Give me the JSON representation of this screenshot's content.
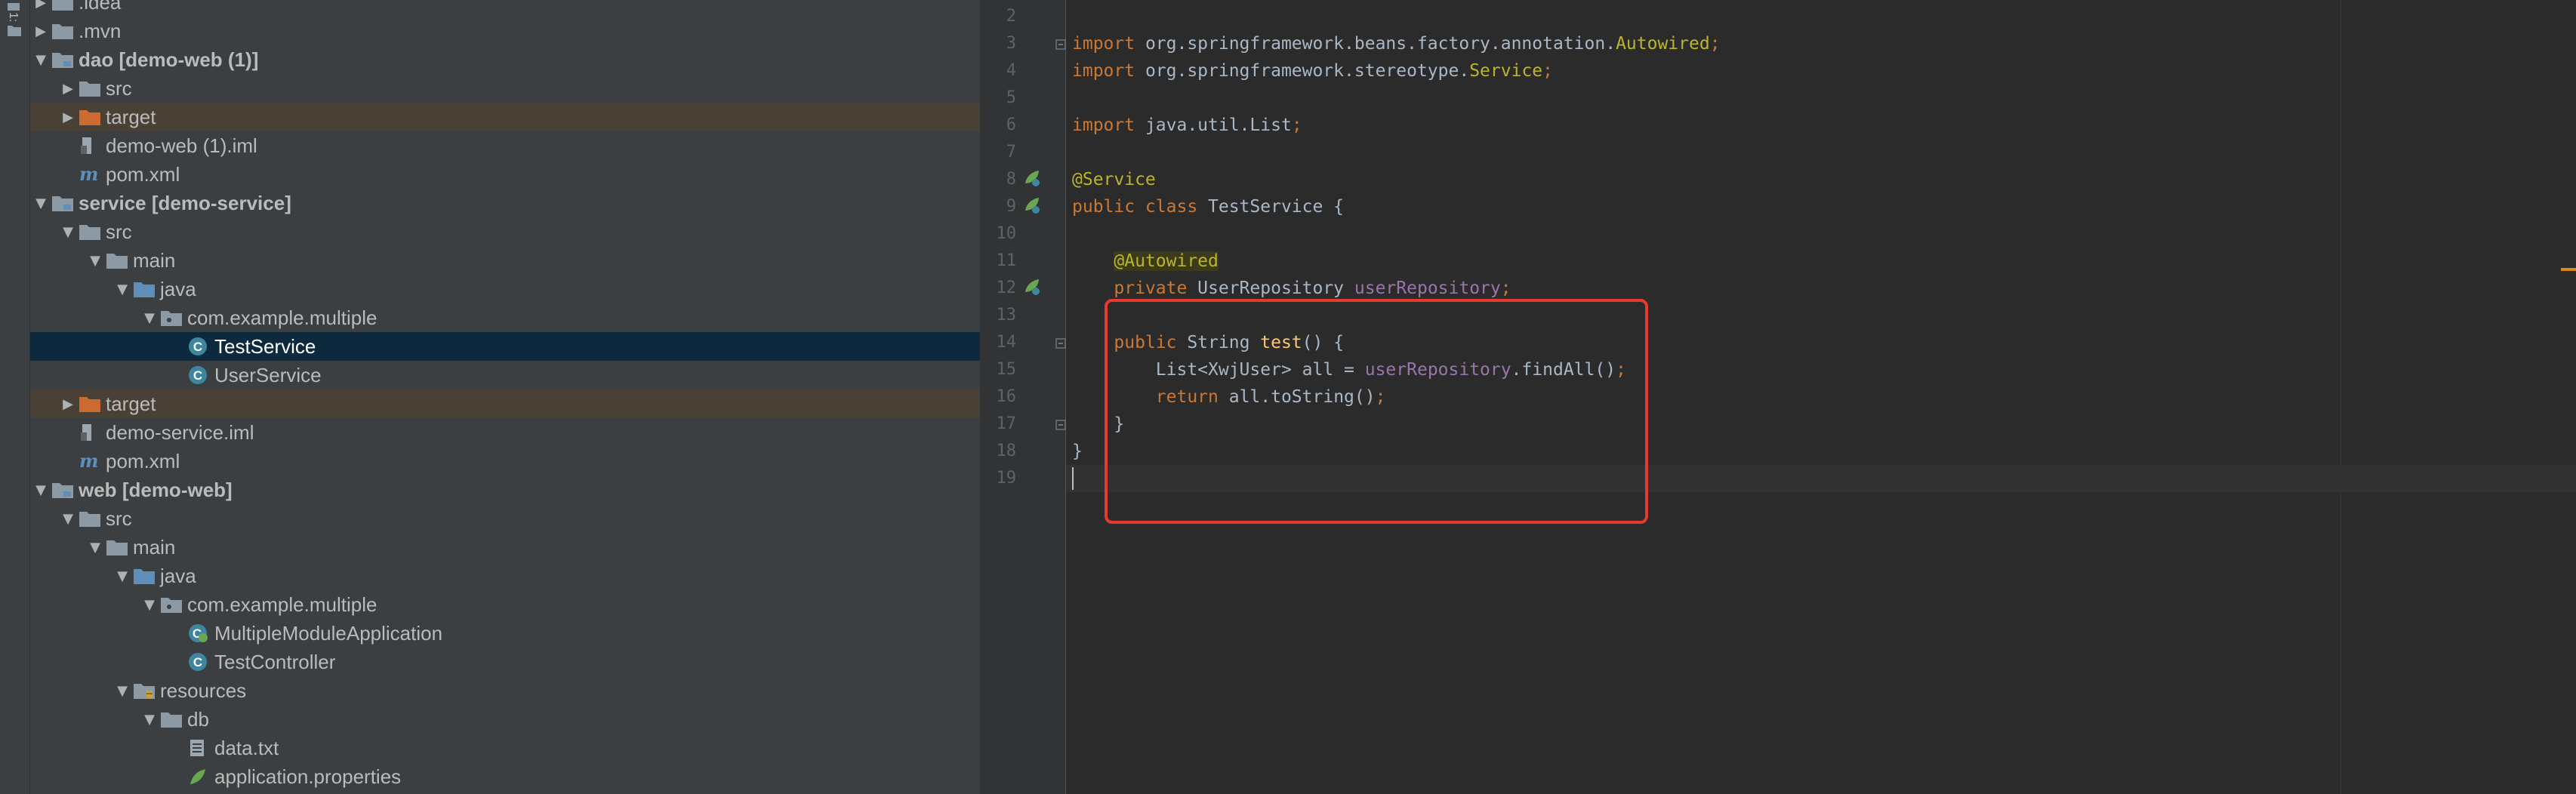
{
  "sidebar": {
    "strip_label": "1:"
  },
  "tree": {
    "rows": [
      {
        "label": ".idea",
        "suffix": ""
      },
      {
        "label": ".mvn",
        "suffix": ""
      },
      {
        "label": "dao",
        "suffix": "[demo-web (1)]"
      },
      {
        "label": "src",
        "suffix": ""
      },
      {
        "label": "target",
        "suffix": ""
      },
      {
        "label": "demo-web (1).iml",
        "suffix": ""
      },
      {
        "label": "pom.xml",
        "suffix": ""
      },
      {
        "label": "service",
        "suffix": "[demo-service]"
      },
      {
        "label": "src",
        "suffix": ""
      },
      {
        "label": "main",
        "suffix": ""
      },
      {
        "label": "java",
        "suffix": ""
      },
      {
        "label": "com.example.multiple",
        "suffix": ""
      },
      {
        "label": "TestService",
        "suffix": ""
      },
      {
        "label": "UserService",
        "suffix": ""
      },
      {
        "label": "target",
        "suffix": ""
      },
      {
        "label": "demo-service.iml",
        "suffix": ""
      },
      {
        "label": "pom.xml",
        "suffix": ""
      },
      {
        "label": "web",
        "suffix": "[demo-web]"
      },
      {
        "label": "src",
        "suffix": ""
      },
      {
        "label": "main",
        "suffix": ""
      },
      {
        "label": "java",
        "suffix": ""
      },
      {
        "label": "com.example.multiple",
        "suffix": ""
      },
      {
        "label": "MultipleModuleApplication",
        "suffix": ""
      },
      {
        "label": "TestController",
        "suffix": ""
      },
      {
        "label": "resources",
        "suffix": ""
      },
      {
        "label": "db",
        "suffix": ""
      },
      {
        "label": "data.txt",
        "suffix": ""
      },
      {
        "label": "application.properties",
        "suffix": ""
      }
    ]
  },
  "editor": {
    "line_numbers": [
      "2",
      "3",
      "4",
      "5",
      "6",
      "7",
      "8",
      "9",
      "10",
      "11",
      "12",
      "13",
      "14",
      "15",
      "16",
      "17",
      "18",
      "19"
    ],
    "lines": [
      [],
      [
        {
          "t": "import ",
          "c": "kw"
        },
        {
          "t": "org.springframework.beans.factory.annotation.",
          "c": ""
        },
        {
          "t": "Autowired",
          "c": "ann"
        },
        {
          "t": ";",
          "c": "kw"
        }
      ],
      [
        {
          "t": "import ",
          "c": "kw"
        },
        {
          "t": "org.springframework.stereotype.",
          "c": ""
        },
        {
          "t": "Service",
          "c": "ann"
        },
        {
          "t": ";",
          "c": "kw"
        }
      ],
      [],
      [
        {
          "t": "import ",
          "c": "kw"
        },
        {
          "t": "java.util.List",
          "c": ""
        },
        {
          "t": ";",
          "c": "kw"
        }
      ],
      [],
      [
        {
          "t": "@Service",
          "c": "ann"
        }
      ],
      [
        {
          "t": "public class ",
          "c": "kw"
        },
        {
          "t": "TestService {",
          "c": ""
        }
      ],
      [],
      [
        {
          "t": "    ",
          "c": ""
        },
        {
          "t": "@Autowired",
          "c": "ann-hl"
        }
      ],
      [
        {
          "t": "    ",
          "c": ""
        },
        {
          "t": "private ",
          "c": "kw"
        },
        {
          "t": "UserRepository ",
          "c": ""
        },
        {
          "t": "userRepository",
          "c": "fld"
        },
        {
          "t": ";",
          "c": "kw"
        }
      ],
      [],
      [
        {
          "t": "    ",
          "c": ""
        },
        {
          "t": "public ",
          "c": "kw"
        },
        {
          "t": "String ",
          "c": ""
        },
        {
          "t": "test",
          "c": "fn"
        },
        {
          "t": "() {",
          "c": ""
        }
      ],
      [
        {
          "t": "        List<XwjUser> all = ",
          "c": ""
        },
        {
          "t": "userRepository",
          "c": "fld"
        },
        {
          "t": ".findAll()",
          "c": ""
        },
        {
          "t": ";",
          "c": "kw"
        }
      ],
      [
        {
          "t": "        ",
          "c": ""
        },
        {
          "t": "return ",
          "c": "kw"
        },
        {
          "t": "all.toString()",
          "c": ""
        },
        {
          "t": ";",
          "c": "kw"
        }
      ],
      [
        {
          "t": "    }",
          "c": ""
        }
      ],
      [
        {
          "t": "}",
          "c": ""
        }
      ],
      []
    ]
  },
  "colors": {
    "folder": "#8b9aa5",
    "folder_src": "#5f8fb8",
    "folder_excluded": "#cd6a30",
    "class_icon": "#3e86a0",
    "selection": "#0d293e",
    "highlight_box": "#e53b2e"
  }
}
